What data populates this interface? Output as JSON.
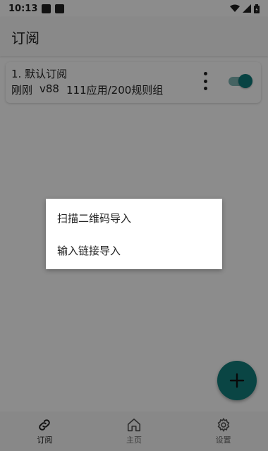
{
  "status_bar": {
    "time": "10:13"
  },
  "app_bar": {
    "title": "订阅"
  },
  "subscription": {
    "title": "1. 默认订阅",
    "time": "刚刚",
    "version": "v88",
    "stats": "111应用/200规则组",
    "enabled": true
  },
  "menu": {
    "items": [
      {
        "label": "扫描二维码导入"
      },
      {
        "label": "输入链接导入"
      }
    ]
  },
  "bottom_nav": {
    "items": [
      {
        "label": "订阅",
        "icon": "link-icon",
        "active": true
      },
      {
        "label": "主页",
        "icon": "home-icon",
        "active": false
      },
      {
        "label": "设置",
        "icon": "gear-icon",
        "active": false
      }
    ]
  },
  "colors": {
    "accent": "#137f7d",
    "switch_thumb": "#0e7a7a"
  }
}
